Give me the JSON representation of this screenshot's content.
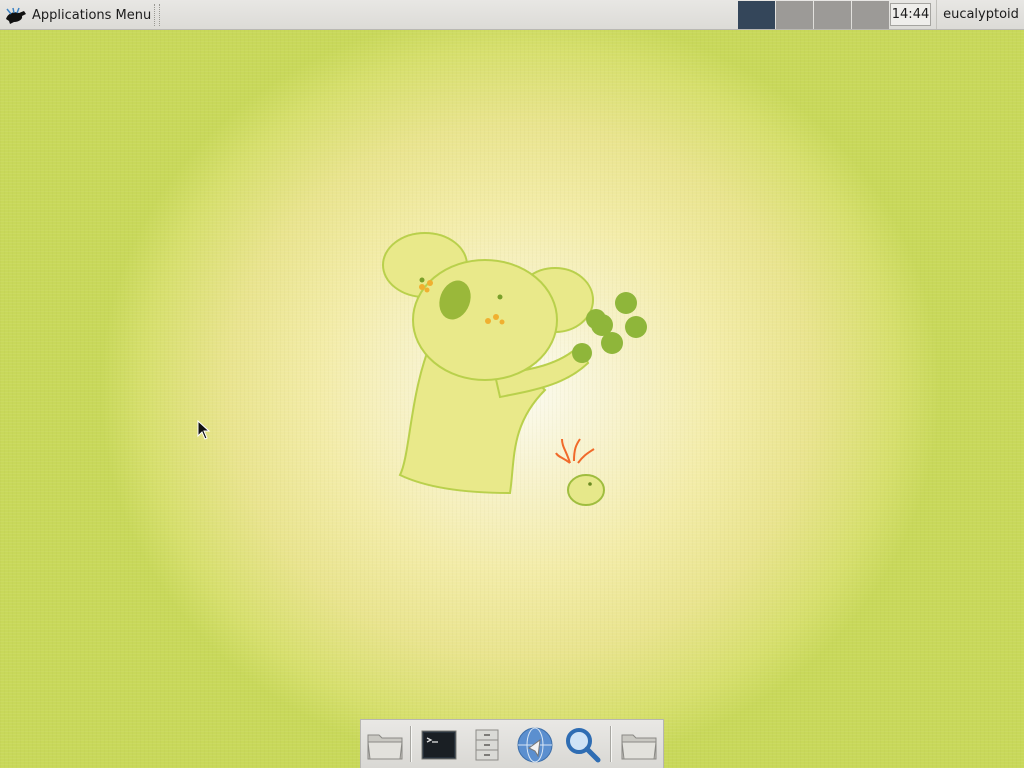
{
  "top_panel": {
    "app_menu_label": "Applications Menu",
    "app_menu_icon": "xfce-mouse-icon",
    "workspaces": [
      {
        "name": "workspace-1",
        "active": true
      },
      {
        "name": "workspace-2",
        "active": false
      },
      {
        "name": "workspace-3",
        "active": false
      },
      {
        "name": "workspace-4",
        "active": false
      }
    ],
    "clock": "14:44",
    "user": "eucalyptoid"
  },
  "dock": {
    "launchers": [
      {
        "name": "folder-icon"
      },
      {
        "name": "terminal-icon"
      },
      {
        "name": "file-cabinet-icon"
      },
      {
        "name": "web-browser-icon"
      },
      {
        "name": "search-icon"
      },
      {
        "name": "folder-icon"
      }
    ]
  },
  "colors": {
    "panel_bg": "#dcdbd7",
    "workspace_active": "#34465a",
    "workspace_inactive": "#9c9a97",
    "wallpaper_center": "#fbfbf1",
    "wallpaper_edge": "#c8d85a"
  }
}
